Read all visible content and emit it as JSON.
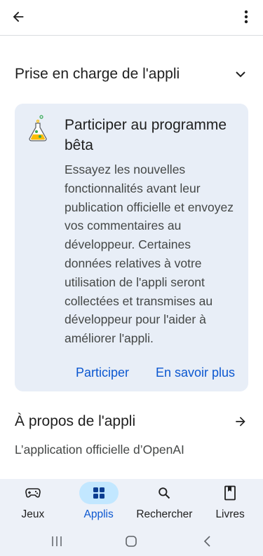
{
  "topbar": {
    "back_icon": "arrow-left-icon",
    "more_icon": "more-vert-icon"
  },
  "support_section": {
    "title": "Prise en charge de l'appli",
    "icon": "chevron-down-icon"
  },
  "beta_card": {
    "icon": "flask-icon",
    "title": "Participer au programme bêta",
    "body": "Essayez les nouvelles fonctionnalités avant leur publication officielle et envoyez vos commentaires au développeur. Certaines données relatives à votre utilisation de l'appli seront collectées et transmises au développeur pour l'aider à améliorer l'appli.",
    "participate_label": "Participer",
    "learn_more_label": "En savoir plus"
  },
  "about_section": {
    "title": "À propos de l'appli",
    "icon": "arrow-right-icon",
    "description": "L’application officielle d’OpenAI"
  },
  "bottom_nav": {
    "items": [
      {
        "label": "Jeux",
        "icon": "gamepad-icon",
        "active": false
      },
      {
        "label": "Applis",
        "icon": "apps-grid-icon",
        "active": true
      },
      {
        "label": "Rechercher",
        "icon": "search-icon",
        "active": false
      },
      {
        "label": "Livres",
        "icon": "book-icon",
        "active": false
      }
    ]
  },
  "system_nav": {
    "recents_icon": "recents-icon",
    "home_icon": "home-icon",
    "back_icon": "back-chevron-icon"
  },
  "colors": {
    "accent": "#0b57d0",
    "card_bg": "#e8eef7",
    "nav_active_pill": "#c2e7ff"
  }
}
